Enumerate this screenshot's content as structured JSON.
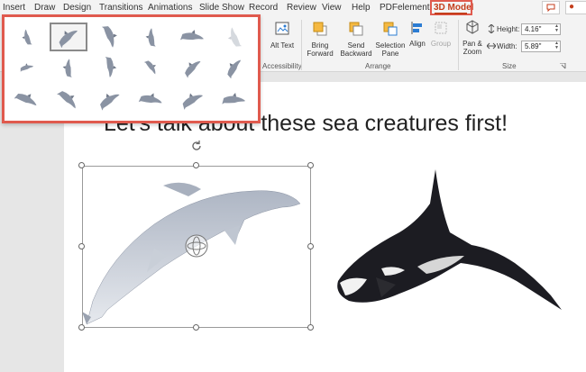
{
  "tabs": [
    "Insert",
    "Draw",
    "Design",
    "Transitions",
    "Animations",
    "Slide Show",
    "Record",
    "Review",
    "View",
    "Help",
    "PDFelement",
    "3D Model"
  ],
  "active_tab": "3D Model",
  "record_label": "R",
  "ribbon": {
    "alt_text": "Alt Text",
    "accessibility_group": "Accessibility",
    "bring_forward": "Bring Forward",
    "send_backward": "Send Backward",
    "selection_pane": "Selection Pane",
    "align": "Align",
    "group": "Group",
    "arrange_group": "Arrange",
    "pan_zoom": "Pan & Zoom",
    "height_label": "Height:",
    "height_value": "4.16\"",
    "width_label": "Width:",
    "width_value": "5.89\"",
    "size_group": "Size"
  },
  "slide": {
    "title": "Let's talk about these sea creatures first!"
  },
  "views_panel": {
    "rows": 3,
    "columns": 6,
    "selected_index": 1
  },
  "colors": {
    "accent": "#c43e1c",
    "highlight_box": "#e05a4e",
    "ribbon_bg": "#f3f3f3"
  }
}
